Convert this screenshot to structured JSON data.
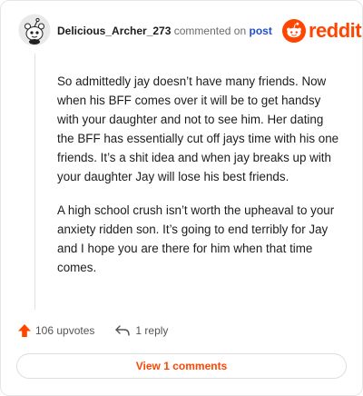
{
  "header": {
    "username": "Delicious_Archer_273",
    "action_text": "commented on",
    "post_link": "post",
    "brand": "reddit"
  },
  "comment": {
    "paragraphs": [
      "So admittedly jay doesn’t have many friends. Now when his BFF comes over it will be to get handsy with your daughter and not to see him. Her dating the BFF has essentially cut off jays time with his one friends. It’s a shit idea and when jay breaks up with your daughter Jay will lose his best friends.",
      "A high school crush isn’t worth the upheaval to your anxiety ridden son. It’s going to end terribly for Jay and I hope you are there for him when that time comes."
    ]
  },
  "footer": {
    "upvotes": "106 upvotes",
    "replies": "1 reply",
    "view_comments": "View 1 comments"
  },
  "colors": {
    "brand": "#ff4500",
    "link": "#1f4fd1",
    "text": "#1c1c1c",
    "muted": "#6b6b6b"
  },
  "icons": {
    "avatar": "snoo-avatar-icon",
    "logo": "reddit-logo-icon",
    "upvote": "upvote-arrow-icon",
    "reply": "reply-arrow-icon"
  }
}
